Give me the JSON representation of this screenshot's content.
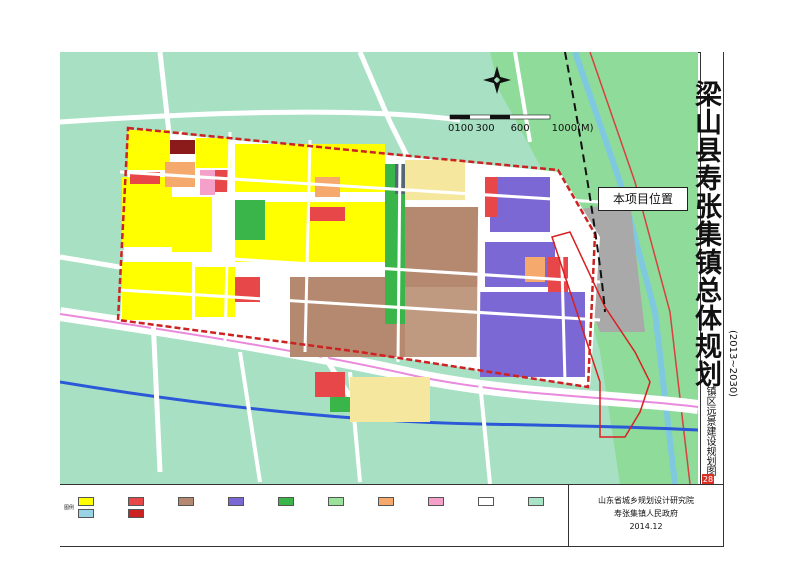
{
  "title": {
    "main": "梁山县寿张集镇总体规划",
    "years": "(2013~2030)",
    "subtitle": "镇区远景建设规划图",
    "sheet_no": "28"
  },
  "callout": {
    "label": "本项目位置"
  },
  "scale_bar": {
    "ticks": [
      "0",
      "100",
      "300",
      "600",
      "1000"
    ],
    "unit": "(M)"
  },
  "credit": {
    "institute": "山东省城乡规划设计研究院",
    "government": "寿张集镇人民政府",
    "date": "2014.12"
  },
  "legend": {
    "key": "图例",
    "colors": {
      "residential": "#ffff00",
      "commercial": "#e8474a",
      "industrial": "#b58970",
      "storage": "#7b68d4",
      "green": "#39b54a",
      "park": "#9be39b",
      "public": "#f6a96d",
      "school": "#f4a0c8",
      "road": "#ffffff",
      "farmland": "#a8e3c8",
      "water": "#9bd3e6",
      "boundary": "#cc2222"
    }
  }
}
